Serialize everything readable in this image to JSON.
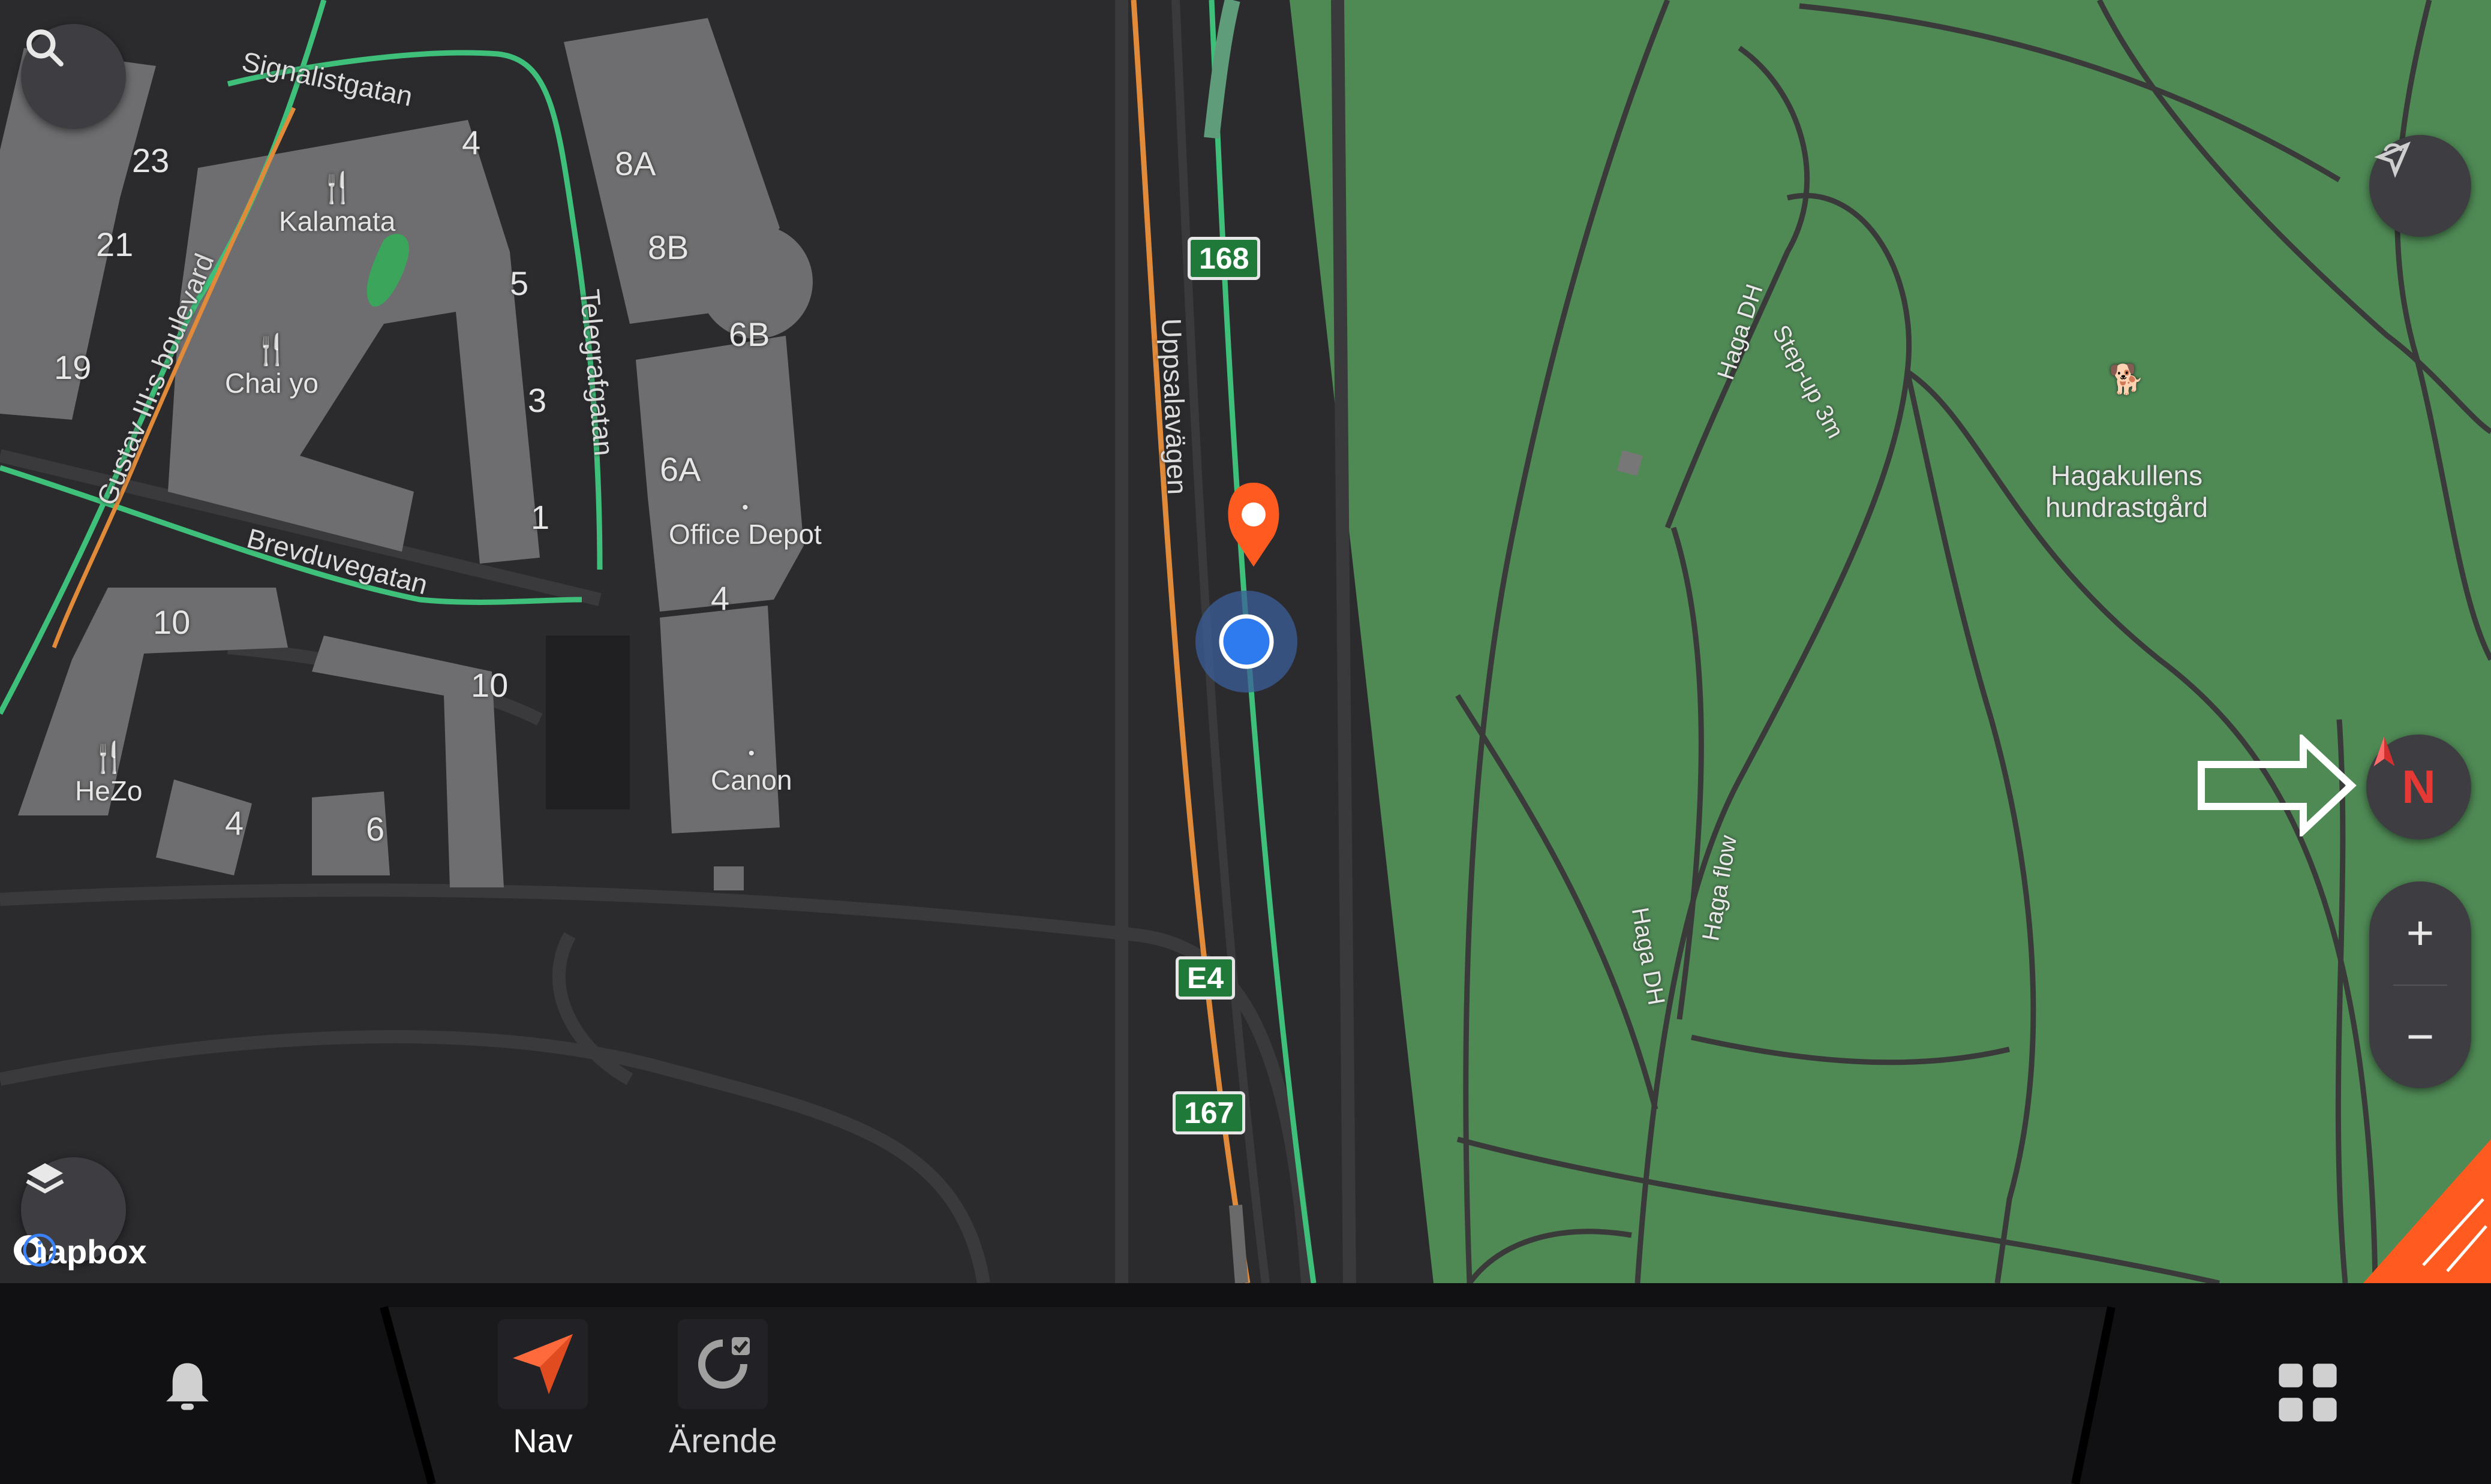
{
  "map": {
    "house_numbers": [
      "23",
      "21",
      "19",
      "4",
      "5",
      "3",
      "1",
      "8A",
      "8B",
      "6B",
      "6A",
      "4",
      "10",
      "10",
      "4",
      "6"
    ],
    "pois": {
      "kalamata": "Kalamata",
      "chai_yo": "Chai yo",
      "hezo": "HeZo",
      "office_depot": "Office Depot",
      "canon": "Canon",
      "hundrastgard": "Hagakullens\nhundrastgård"
    },
    "streets": {
      "signalistgatan": "Signalistgatan",
      "telegrafgatan": "Telegrafgatan",
      "gustav": "Gustav III:s boulevard",
      "brevduvegatan": "Brevduvegatan",
      "uppsalavagen": "Uppsalavägen",
      "haga_dh_top": "Haga DH",
      "step_up": "Step-up 3m",
      "haga_flow": "Haga flow",
      "haga_dh_bottom": "Haga DH"
    },
    "route_shields": [
      "168",
      "E4",
      "167"
    ],
    "attribution": "mapbox",
    "compass_label": "N",
    "zoom_in": "+",
    "zoom_out": "−",
    "colors": {
      "park": "#4f8a55",
      "land": "#2b2b2e",
      "building": "#6e6e70",
      "route": "#3ec07a",
      "road_orange": "#e08a3a",
      "pin": "#ff5a1f",
      "location": "#3b82f6"
    }
  },
  "icons": [
    "search-icon",
    "layers-icon",
    "gps-mode-icon",
    "compass-icon",
    "arrow-annotation-icon",
    "notification-bell-icon",
    "navigation-arrow-icon",
    "refresh-icon",
    "apps-grid-icon",
    "info-icon",
    "dog-icon"
  ],
  "bottom_bar": {
    "tabs": [
      {
        "label": "Nav"
      },
      {
        "label": "Ärende"
      }
    ]
  }
}
